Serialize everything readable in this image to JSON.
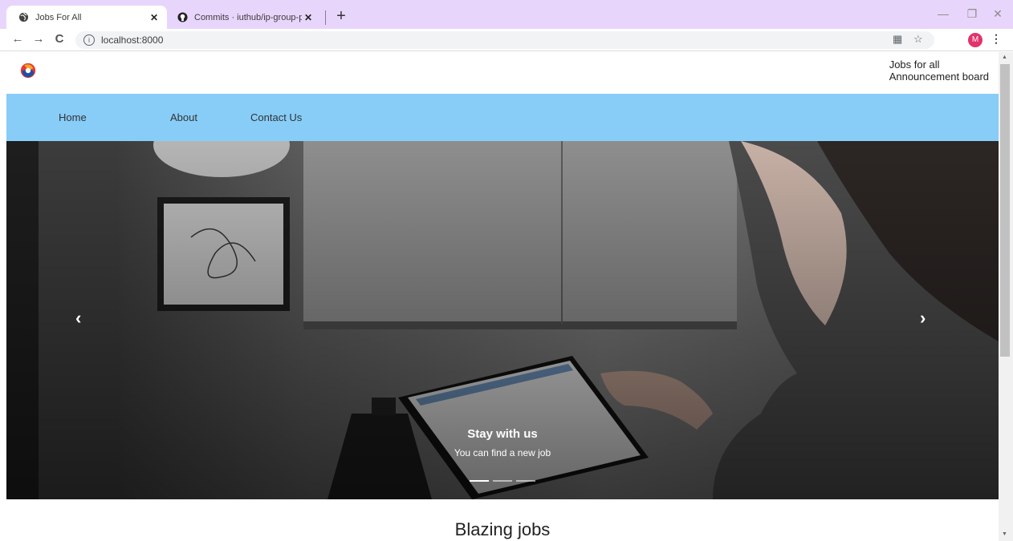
{
  "browser": {
    "tabs": [
      {
        "title": "Jobs For All",
        "favicon": "globe-icon"
      },
      {
        "title": "Commits · iuthub/ip-group-proje",
        "favicon": "github-icon"
      }
    ],
    "url": "localhost:8000",
    "profile_initial": "M"
  },
  "site": {
    "brand_line1": "Jobs for all",
    "brand_line2": "Announcement board",
    "nav": [
      "Home",
      "About",
      "Contact Us"
    ],
    "nav_color": "#87cdf8",
    "carousel": {
      "caption_title": "Stay with us",
      "caption_text": "You can find a new job",
      "slides": 3,
      "active_slide": 1
    },
    "section_title": "Blazing jobs"
  }
}
